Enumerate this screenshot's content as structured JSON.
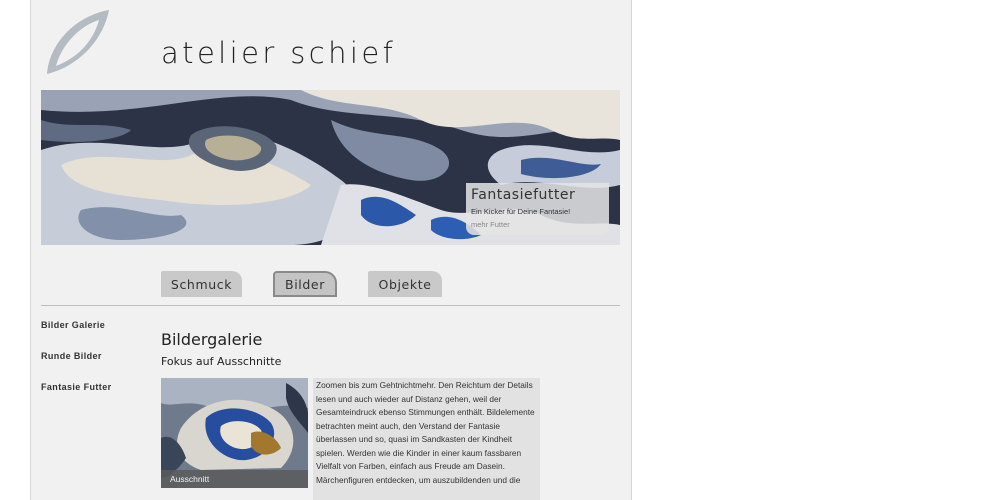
{
  "site": {
    "title": "atelier schief"
  },
  "banner": {
    "title": "Fantasiefutter",
    "subtitle": "Ein Kicker für Deine Fantasie!",
    "link": "mehr Futter"
  },
  "nav": {
    "tabs": [
      {
        "label": "Schmuck",
        "active": false
      },
      {
        "label": "Bilder",
        "active": true
      },
      {
        "label": "Objekte",
        "active": false
      }
    ]
  },
  "sidebar": {
    "items": [
      {
        "label": "Bilder Galerie"
      },
      {
        "label": "Runde Bilder"
      },
      {
        "label": "Fantasie Futter"
      }
    ]
  },
  "main": {
    "heading": "Bildergalerie",
    "subheading": "Fokus auf Ausschnitte",
    "image_caption": "Ausschnitt",
    "paragraph": "Zoomen bis zum Gehtnichtmehr. Den Reichtum der Details lesen und auch wieder auf Distanz gehen, weil der Gesamteindruck ebenso Stimmungen enthält. Bildelemente betrachten meint auch, den Verstand der Fantasie überlassen und so, quasi im Sandkasten der Kindheit spielen. Werden wie die Kinder in einer kaum fassbaren Vielfalt von Farben, einfach aus Freude am Dasein.",
    "paragraph_2": "Märchenfiguren entdecken, um auszubildenden und die"
  },
  "colors": {
    "page_background": "#f1f1f1",
    "tab_background": "#c9c9c9",
    "text": "#333333"
  }
}
